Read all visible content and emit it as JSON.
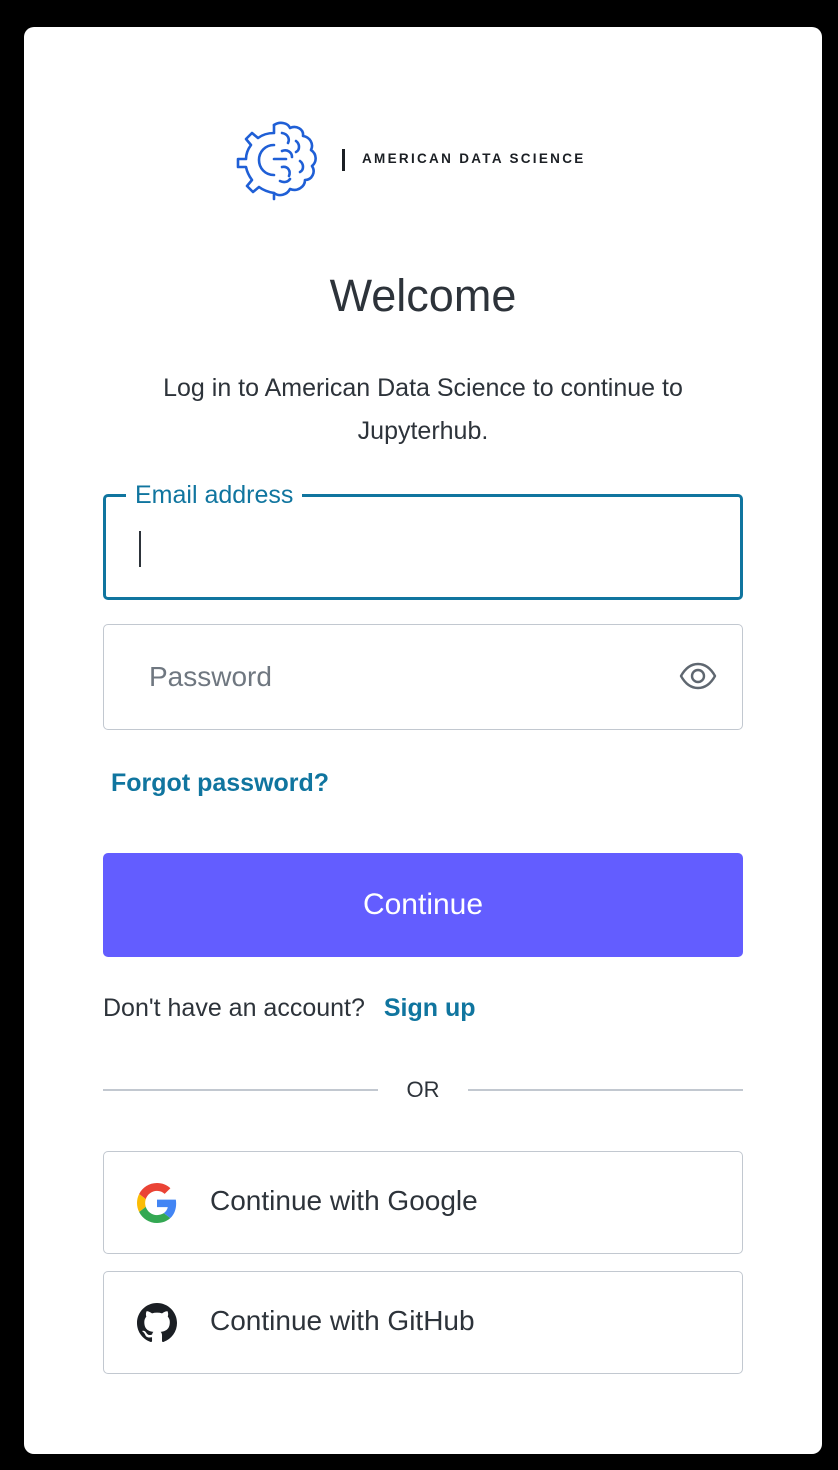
{
  "brand": {
    "name": "AMERICAN DATA SCIENCE",
    "logo_icon": "brain-gear-icon",
    "accent_color": "#1f5fd6"
  },
  "header": {
    "title": "Welcome",
    "subtitle": "Log in to American Data Science to continue to Jupyterhub."
  },
  "form": {
    "email": {
      "label": "Email address",
      "value": ""
    },
    "password": {
      "placeholder": "Password",
      "toggle_icon": "eye-icon"
    },
    "forgot_link": "Forgot password?",
    "submit_label": "Continue",
    "submit_color": "#635dff"
  },
  "signup": {
    "prompt": "Don't have an account?",
    "link": "Sign up"
  },
  "divider": {
    "text": "OR"
  },
  "social": [
    {
      "label": "Continue with Google",
      "icon": "google-icon"
    },
    {
      "label": "Continue with GitHub",
      "icon": "github-icon"
    }
  ],
  "colors": {
    "link": "#10759f",
    "focus_border": "#10759f",
    "text": "#2d333a",
    "border": "#c2c8d0"
  }
}
